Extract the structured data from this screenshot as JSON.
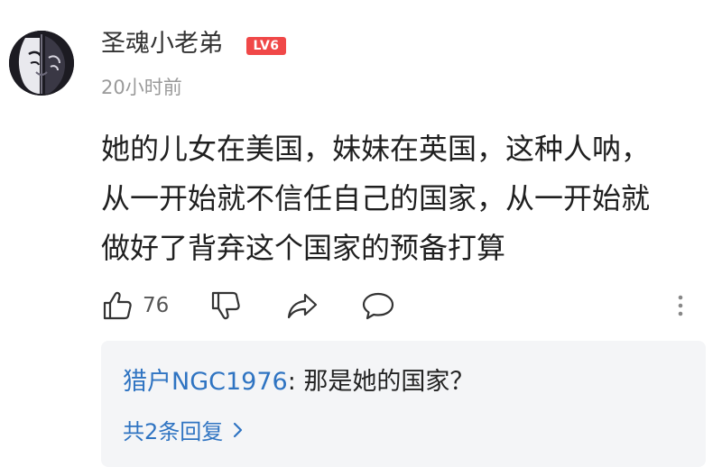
{
  "comment": {
    "author": "圣魂小老弟",
    "level_badge": "LV6",
    "timestamp": "20小时前",
    "body_lines": [
      "她的儿女在美国，妹妹在英国，这种人呐，",
      "从一开始就不信任自己的国家，从一开始就",
      "做好了背弃这个国家的预备打算"
    ],
    "like_count": "76",
    "icons": {
      "like": "thumbs-up-icon",
      "dislike": "thumbs-down-icon",
      "share": "share-arrow-icon",
      "reply": "speech-bubble-icon",
      "more": "vertical-dots-icon"
    }
  },
  "replies": {
    "first_reply": {
      "author": "猎户NGC1976",
      "separator": ": ",
      "text": "那是她的国家？"
    },
    "more_label": "共2条回复",
    "more_icon": "chevron-right-icon"
  },
  "colors": {
    "level_badge": "#f04848",
    "link_blue": "#2f74c2",
    "timestamp_gray": "#9a9a9a",
    "reply_bg": "#f4f5f7"
  }
}
